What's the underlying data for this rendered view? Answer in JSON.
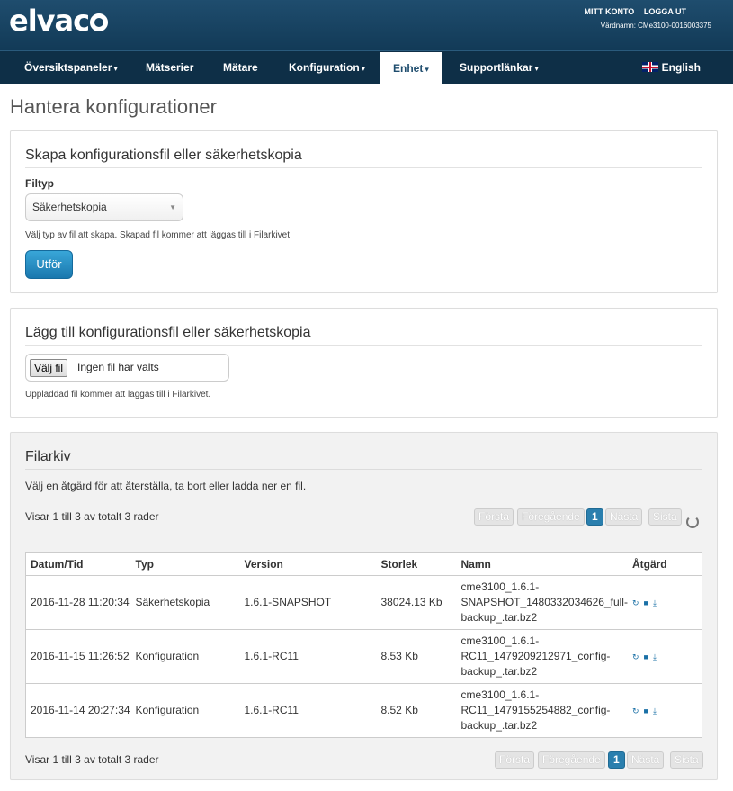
{
  "brand": {
    "name": "elvac"
  },
  "header": {
    "links": [
      "MITT KONTO",
      "LOGGA UT"
    ],
    "hostname_label": "Värdnamn: CMe3100-0016003375"
  },
  "nav": {
    "items": [
      {
        "label": "Översiktspaneler",
        "caret": "▾"
      },
      {
        "label": "Mätserier",
        "caret": ""
      },
      {
        "label": "Mätare",
        "caret": ""
      },
      {
        "label": "Konfiguration",
        "caret": "▾"
      },
      {
        "label": "Enhet",
        "caret": "▾"
      },
      {
        "label": "Supportlänkar",
        "caret": "▾"
      }
    ],
    "language": "English"
  },
  "page": {
    "title": "Hantera konfigurationer"
  },
  "create": {
    "heading": "Skapa konfigurationsfil eller säkerhetskopia",
    "filetype_label": "Filtyp",
    "filetype_value": "Säkerhetskopia",
    "hint": "Välj typ av fil att skapa. Skapad fil kommer att läggas till i Filarkivet",
    "submit_label": "Utför"
  },
  "upload": {
    "heading": "Lägg till konfigurationsfil eller säkerhetskopia",
    "choose_label": "Välj fil",
    "no_file_label": "Ingen fil har valts",
    "hint": "Uppladdad fil kommer att läggas till i Filarkivet."
  },
  "archive": {
    "heading": "Filarkiv",
    "description": "Välj en åtgärd för att återställa, ta bort eller ladda ner en fil.",
    "info_text": "Visar 1 till 3 av totalt 3 rader",
    "pager": {
      "first": "Första",
      "prev": "Föregående",
      "current": "1",
      "next": "Nästa",
      "last": "Sista"
    },
    "columns": [
      "Datum/Tid",
      "Typ",
      "Version",
      "Storlek",
      "Namn",
      "Åtgärd"
    ],
    "rows": [
      {
        "date": "2016-11-28 11:20:34",
        "type": "Säkerhetskopia",
        "version": "1.6.1-SNAPSHOT",
        "size": "38024.13 Kb",
        "name": [
          "cme3100_1.6.1-",
          "SNAPSHOT_1480332034626_full-",
          "backup_.tar.bz2"
        ]
      },
      {
        "date": "2016-11-15 11:26:52",
        "type": "Konfiguration",
        "version": "1.6.1-RC11",
        "size": "8.53 Kb",
        "name": [
          "cme3100_1.6.1-",
          "RC11_1479209212971_config-",
          "backup_.tar.bz2"
        ]
      },
      {
        "date": "2016-11-14 20:27:34",
        "type": "Konfiguration",
        "version": "1.6.1-RC11",
        "size": "8.52 Kb",
        "name": [
          "cme3100_1.6.1-",
          "RC11_1479155254882_config-",
          "backup_.tar.bz2"
        ]
      }
    ],
    "action_icons": [
      "restore-icon",
      "trash-icon",
      "download-icon"
    ]
  }
}
